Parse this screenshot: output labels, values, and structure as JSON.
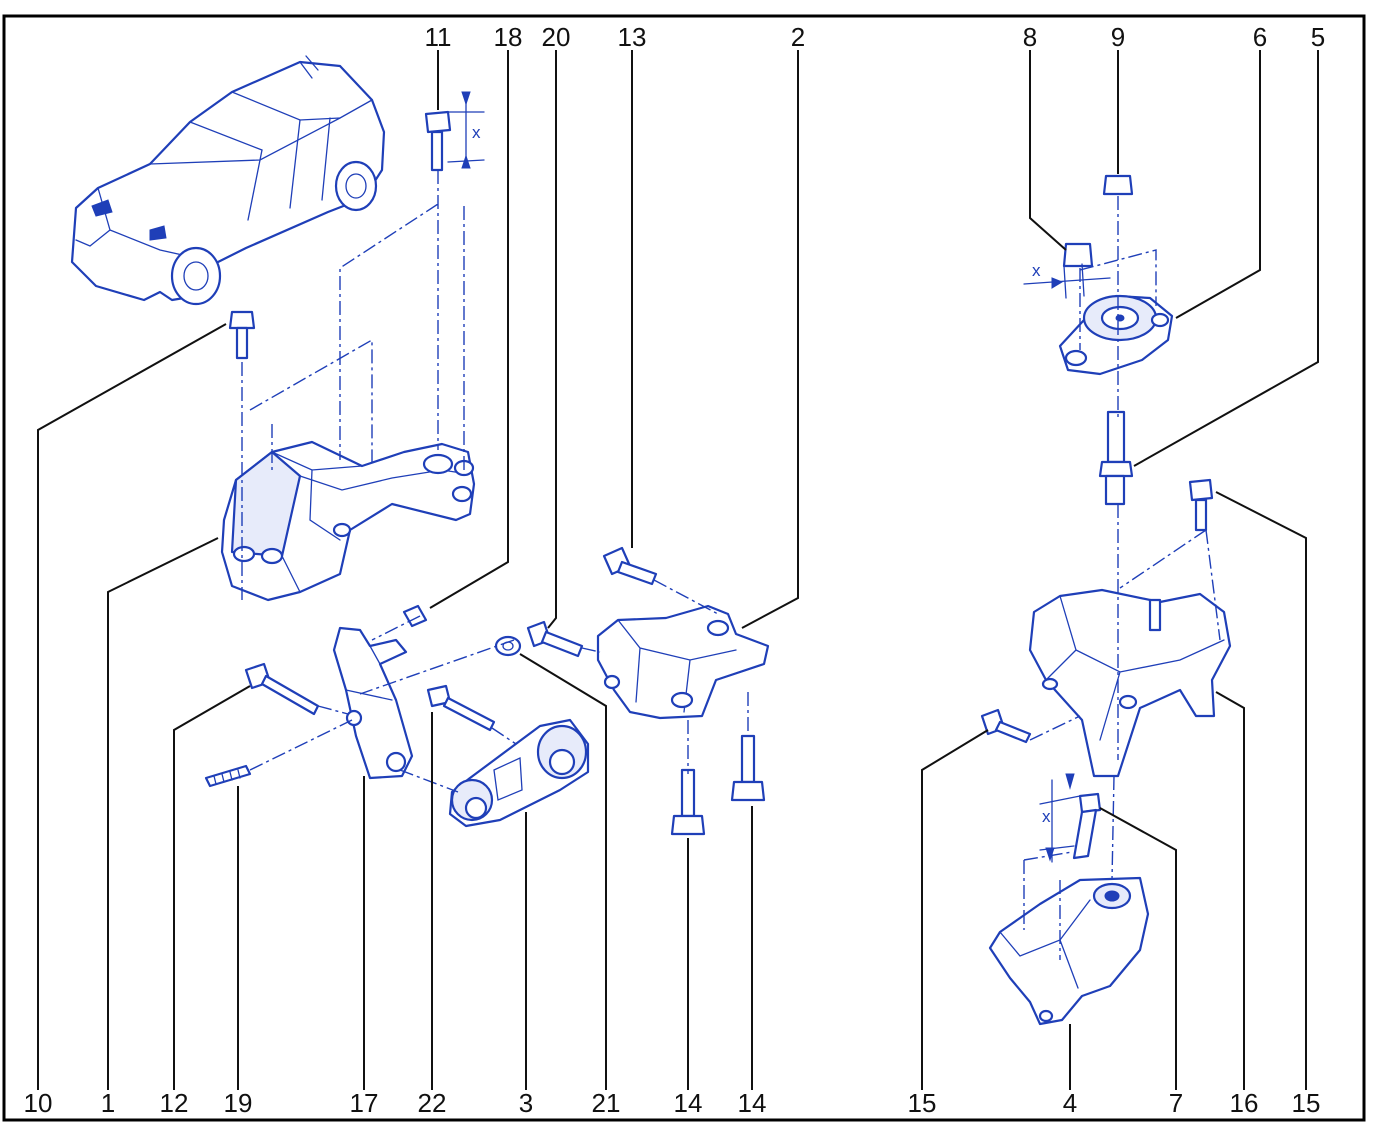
{
  "diagram": {
    "labels_top": [
      "11",
      "18",
      "20",
      "13",
      "2",
      "8",
      "9",
      "6",
      "5"
    ],
    "labels_bottom": [
      "10",
      "1",
      "12",
      "19",
      "17",
      "22",
      "3",
      "21",
      "14",
      "14",
      "15",
      "4",
      "7",
      "16",
      "15"
    ],
    "dimension_marks": [
      "x",
      "x",
      "x"
    ],
    "colors": {
      "line_art": "#1f3fb8",
      "text": "#111111",
      "frame": "#000000",
      "background": "#ffffff"
    },
    "icons": [
      "car-icon",
      "engine-mount-bracket-icon",
      "torque-rod-icon",
      "gearbox-mount-icon",
      "bolt-icon",
      "nut-icon",
      "stud-icon"
    ]
  }
}
